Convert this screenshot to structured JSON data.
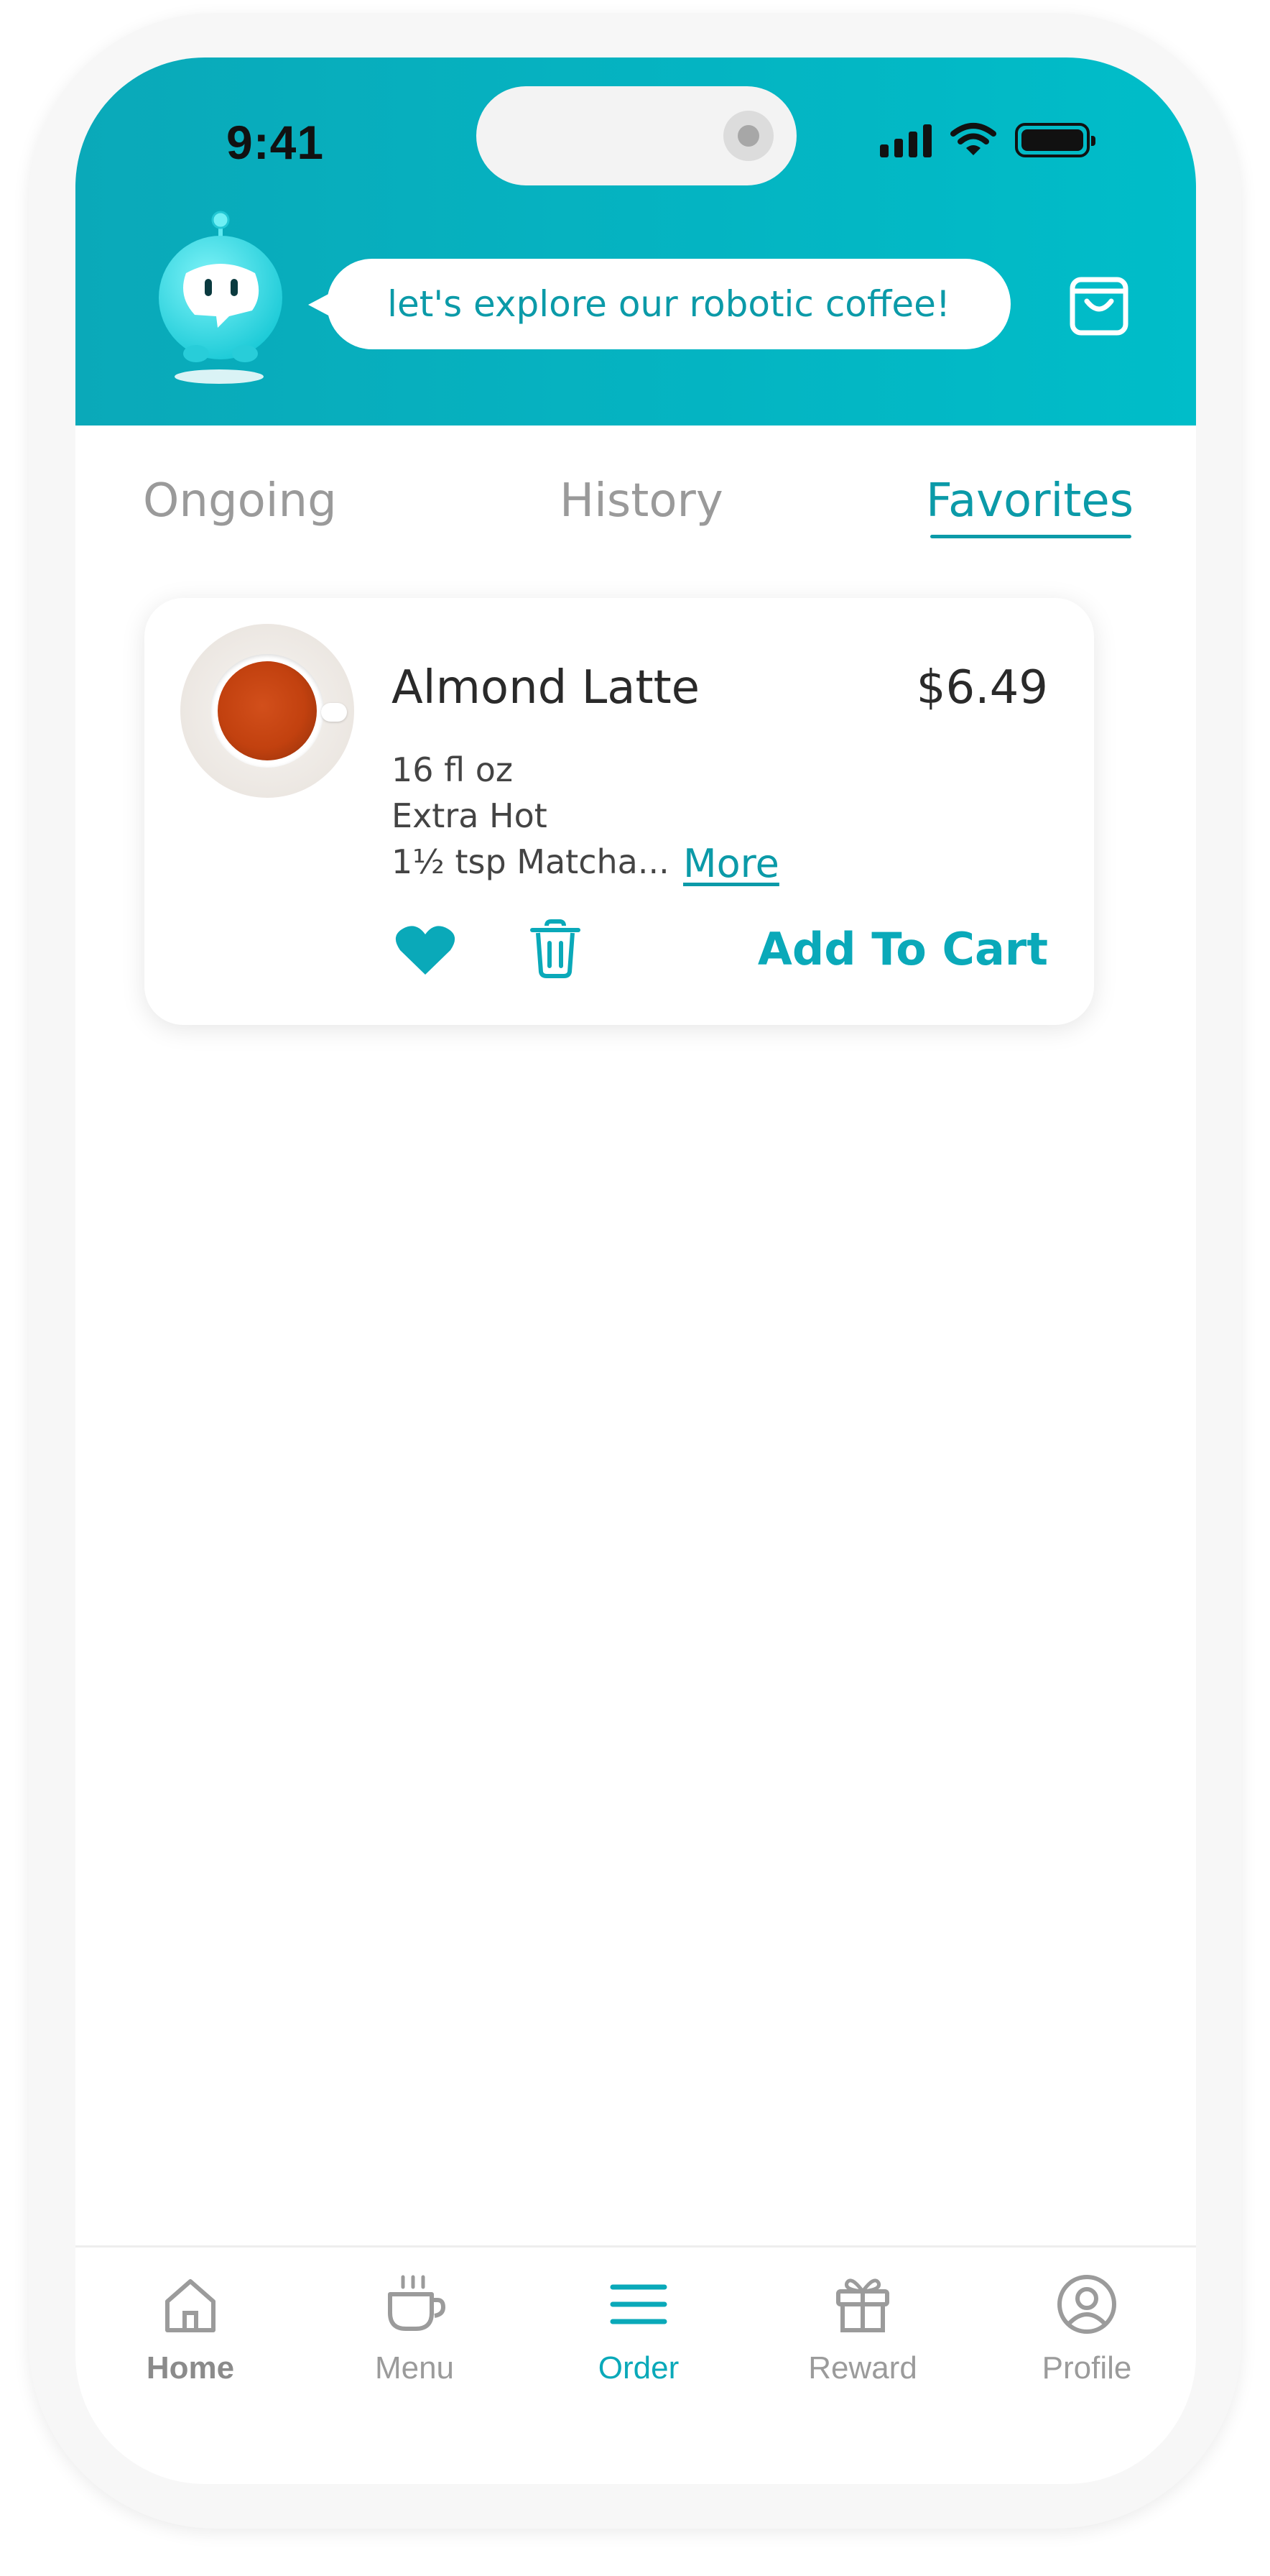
{
  "status_bar": {
    "time": "9:41"
  },
  "header": {
    "speech_bubble": "let's explore our robotic coffee!",
    "cart_icon": "shopping-bag-icon",
    "mascot": "robot-mascot",
    "background_color": "#00bdc9"
  },
  "tabs": [
    {
      "label": "Ongoing",
      "active": false
    },
    {
      "label": "History",
      "active": false
    },
    {
      "label": "Favorites",
      "active": true
    }
  ],
  "favorites": [
    {
      "name": "Almond Latte",
      "price": "$6.49",
      "details": [
        "16 fl oz",
        "Extra Hot",
        "1½ tsp Matcha..."
      ],
      "more_label": "More",
      "favorited": true,
      "add_to_cart_label": "Add To Cart"
    }
  ],
  "bottom_nav": [
    {
      "label": "Home",
      "icon": "home-icon",
      "active": false
    },
    {
      "label": "Menu",
      "icon": "coffee-cup-icon",
      "active": false
    },
    {
      "label": "Order",
      "icon": "list-icon",
      "active": true
    },
    {
      "label": "Reward",
      "icon": "gift-icon",
      "active": false
    },
    {
      "label": "Profile",
      "icon": "profile-icon",
      "active": false
    }
  ],
  "colors": {
    "accent": "#0aa9b9",
    "text_dark": "#2a2a2a",
    "text_muted": "#9a9a9a"
  }
}
